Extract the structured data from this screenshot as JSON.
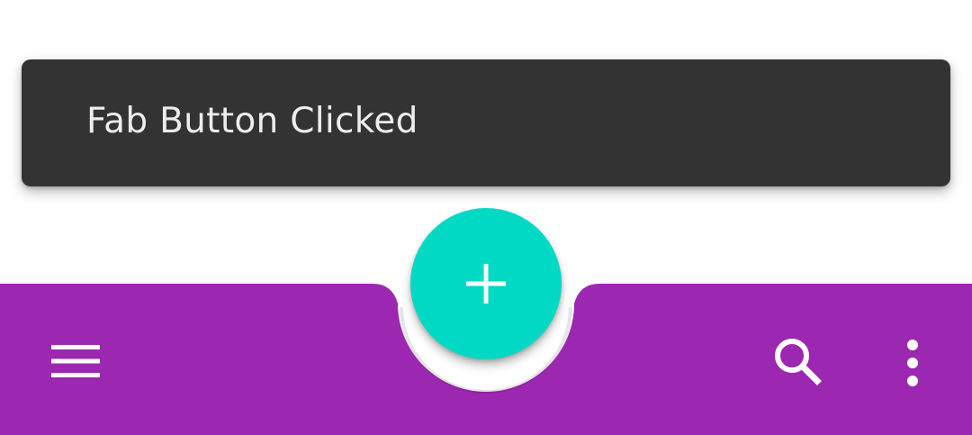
{
  "snackbar": {
    "message": "Fab Button Clicked"
  },
  "bottom_app_bar": {
    "color": "#9c27b0",
    "nav_icon": "menu-icon",
    "actions": [
      {
        "icon": "search-icon"
      },
      {
        "icon": "more-vertical-icon"
      }
    ]
  },
  "fab": {
    "icon": "plus-icon",
    "color": "#02d9c4"
  },
  "colors": {
    "snackbar_background": "#333333",
    "snackbar_text": "#ededed",
    "icon": "#ffffff"
  }
}
